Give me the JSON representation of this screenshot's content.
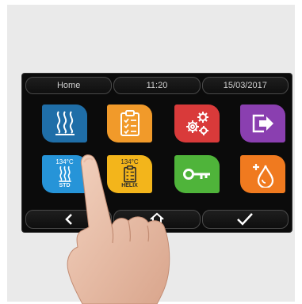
{
  "header": {
    "title": "Home",
    "time": "11:20",
    "date": "15/03/2017"
  },
  "tiles": [
    {
      "icon": "heat-waves-icon",
      "color": "#1f6ea8"
    },
    {
      "icon": "clipboard-checklist-icon",
      "color": "#f19a2a"
    },
    {
      "icon": "gears-icon",
      "color": "#d93a3a"
    },
    {
      "icon": "exit-arrow-icon",
      "color": "#8a3fb0"
    },
    {
      "icon": "heat-waves-icon",
      "color": "#2694d8",
      "temp": "134°C",
      "label": "STD"
    },
    {
      "icon": "clipboard-checklist-icon",
      "color": "#f3b51b",
      "temp": "134°C",
      "label": "HELIX"
    },
    {
      "icon": "key-icon",
      "color": "#4fb43a"
    },
    {
      "icon": "water-drop-plus-icon",
      "color": "#f07a1f"
    }
  ],
  "footer": {
    "back_icon": "chevron-left-icon",
    "home_icon": "home-icon",
    "confirm_icon": "checkmark-icon"
  }
}
